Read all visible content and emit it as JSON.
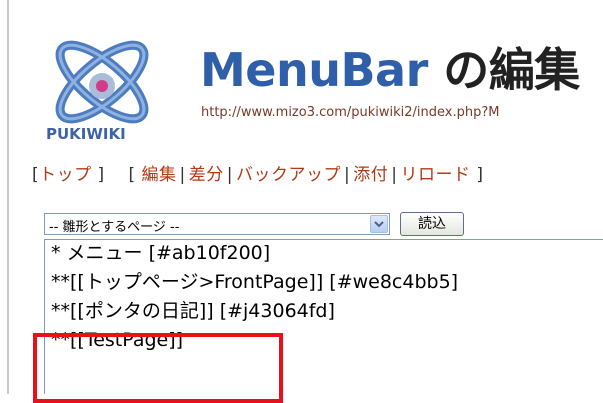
{
  "header": {
    "logo_text": "PUKIWIKI",
    "title_name": "MenuBar",
    "title_rest": " の編集",
    "url": "http://www.mizo3.com/pukiwiki2/index.php?M"
  },
  "menu": {
    "open_bracket": "[",
    "close_bracket": "]",
    "separator": "|",
    "top_label": "トップ",
    "edit_label": "編集",
    "diff_label": "差分",
    "backup_label": "バックアップ",
    "attach_label": "添付",
    "reload_label": "リロード"
  },
  "template": {
    "selected": "-- 雛形とするページ --",
    "load_label": "読込"
  },
  "editor": {
    "lines": [
      "* メニュー [#ab10f200]",
      "**[[トップページ>FrontPage]] [#we8c4bb5]",
      "**[[ポンタの日記]] [#j43064fd]",
      "**[[TestPage]]"
    ]
  },
  "colors": {
    "title_blue": "#2f5fa8",
    "link_red": "#b03a15",
    "highlight_red": "#e8101a"
  }
}
